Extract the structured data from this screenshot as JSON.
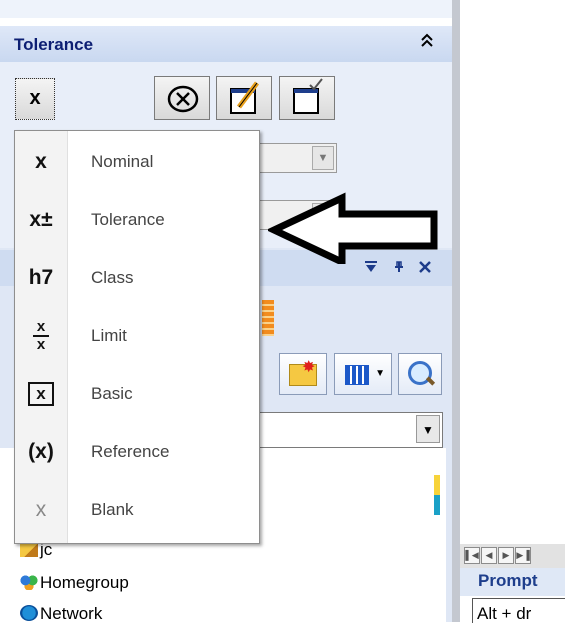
{
  "panel": {
    "title": "Tolerance",
    "collapse_glyph": "⌃⌃"
  },
  "tolerance_type_button": {
    "glyph": "x"
  },
  "menu": {
    "items": [
      {
        "label": "Nominal",
        "icon": "nominal-icon"
      },
      {
        "label": "Tolerance",
        "icon": "tolerance-icon"
      },
      {
        "label": "Class",
        "icon": "class-icon"
      },
      {
        "label": "Limit",
        "icon": "limit-icon"
      },
      {
        "label": "Basic",
        "icon": "basic-icon"
      },
      {
        "label": "Reference",
        "icon": "reference-icon"
      },
      {
        "label": "Blank",
        "icon": "blank-icon"
      }
    ]
  },
  "icons_text": {
    "nominal": "x",
    "tolerance": "x±",
    "class": "h7",
    "limit_top": "x",
    "limit_bottom": "x",
    "basic": "x",
    "reference": "(x)",
    "blank": "x"
  },
  "tree": {
    "items": [
      {
        "label": "jc"
      },
      {
        "label": "Homegroup"
      },
      {
        "label": "Network"
      }
    ]
  },
  "prompt": {
    "title": "Prompt",
    "text": "Alt + dr"
  },
  "colors": {
    "header_text": "#0d1f73",
    "accent": "#1e3e8c",
    "arrow": "#000000"
  }
}
